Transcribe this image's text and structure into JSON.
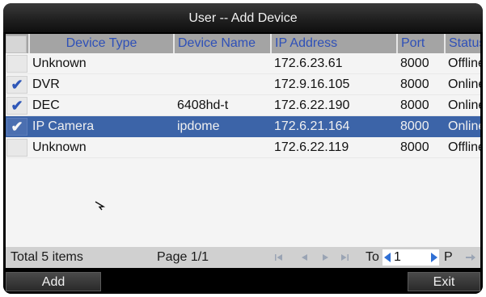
{
  "dialog": {
    "title": "User -- Add Device"
  },
  "table": {
    "columns": [
      "Device Type",
      "Device Name",
      "IP Address",
      "Port",
      "Status"
    ],
    "rows": [
      {
        "checked": false,
        "selected": false,
        "cells": [
          "Unknown",
          "",
          "172.6.23.61",
          "8000",
          "Offline"
        ]
      },
      {
        "checked": true,
        "selected": false,
        "cells": [
          "DVR",
          "",
          "172.9.16.105",
          "8000",
          "Online"
        ]
      },
      {
        "checked": true,
        "selected": false,
        "cells": [
          "DEC",
          "6408hd-t",
          "172.6.22.190",
          "8000",
          "Online"
        ]
      },
      {
        "checked": true,
        "selected": true,
        "cells": [
          "IP Camera",
          "ipdome",
          "172.6.21.164",
          "8000",
          "Online"
        ]
      },
      {
        "checked": false,
        "selected": false,
        "cells": [
          "Unknown",
          "",
          "172.6.22.119",
          "8000",
          "Offline"
        ]
      }
    ],
    "check_glyph": "✔"
  },
  "footer": {
    "total": "Total 5 items",
    "page": "Page 1/1",
    "goto_label": "To",
    "goto_value": "1",
    "goto_suffix": "P"
  },
  "buttons": {
    "add": "Add",
    "exit": "Exit"
  },
  "colors": {
    "header_text": "#2e50b8",
    "selected_row": "#3c64a8",
    "header_bg": "#a4a4a4"
  }
}
